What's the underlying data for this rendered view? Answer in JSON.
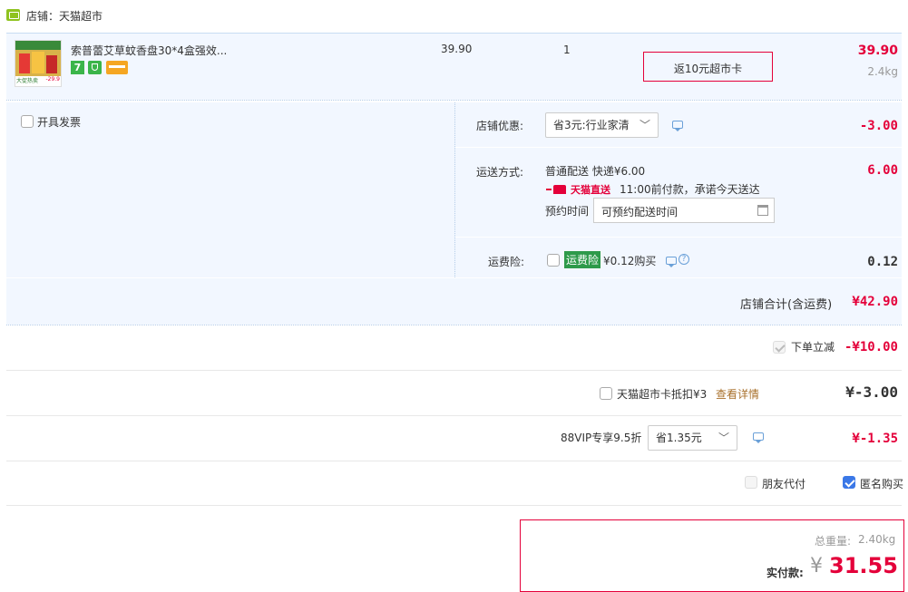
{
  "shop": {
    "label": "店铺：天猫超市"
  },
  "item": {
    "title": "索普蕾艾草蚊香盘30*4盒强效...",
    "price": "39.90",
    "qty": "1",
    "promo": "返10元超市卡",
    "subtotal": "39.90",
    "weight": "2.4kg",
    "thumb_price_tag": "-29.9",
    "thumb_label": "大促热卖"
  },
  "invoice": {
    "label": "开具发票"
  },
  "discount": {
    "label": "店铺优惠:",
    "select": "省3元:行业家清",
    "amount": "-3.00"
  },
  "shipping": {
    "label": "运送方式:",
    "method": "普通配送 快递¥6.00",
    "badge": "天猫直送",
    "promise": "11:00前付款，承诺今天送达",
    "schedule_label": "预约时间",
    "schedule_placeholder": "可预约配送时间",
    "amount": "6.00"
  },
  "insurance": {
    "label": "运费险:",
    "tag": "运费险",
    "price": "¥0.12购买",
    "amount": "0.12"
  },
  "store_total": {
    "label": "店铺合计(含运费)",
    "amount": "¥42.90"
  },
  "instant_discount": {
    "label": "下单立减",
    "amount": "-¥10.00"
  },
  "card": {
    "label": "天猫超市卡抵扣¥3",
    "link": "查看详情",
    "amount": "¥-3.00"
  },
  "vip": {
    "label": "88VIP专享9.5折",
    "select": "省1.35元",
    "amount": "¥-1.35"
  },
  "options": {
    "friend_pay": "朋友代付",
    "anonymous": "匿名购买"
  },
  "summary": {
    "weight_label": "总重量:",
    "weight": "2.40kg",
    "pay_label": "实付款:",
    "currency": "¥",
    "pay": "31.55"
  },
  "colors": {
    "accent_red": "#e4003a",
    "panel_bg": "#f2f7ff",
    "link_orange": "#a8702b",
    "tmall_green": "#2e9a4a"
  }
}
